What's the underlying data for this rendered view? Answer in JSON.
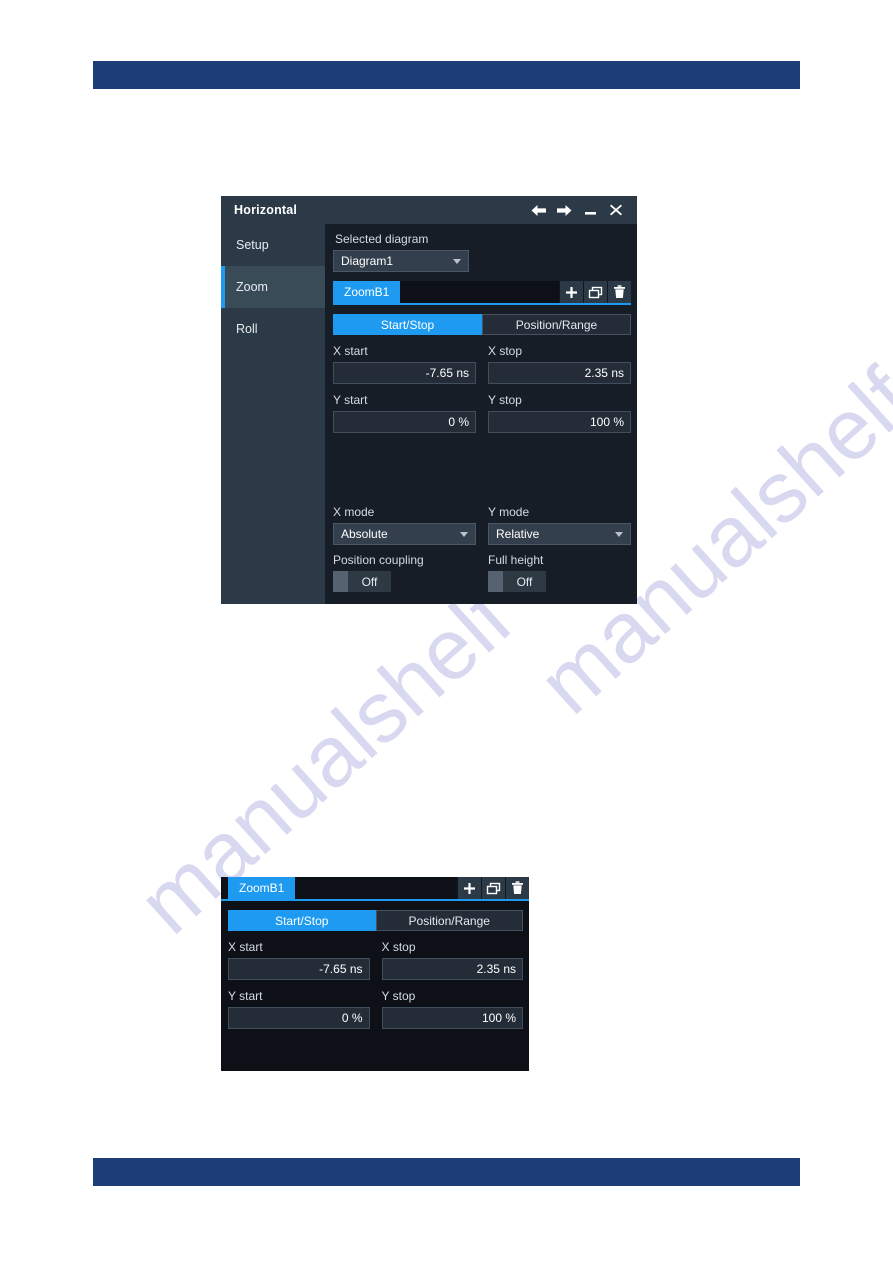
{
  "page": {
    "watermark_text": "manualshelf",
    "header_bar_color": "#1c3d75",
    "footer_bar_color": "#1c3d75"
  },
  "theme": {
    "accent": "#1e9bf0",
    "dialog_bg": "#161d26",
    "titlebar_bg": "#2b3a46",
    "sidebar_bg": "#2b3a46",
    "input_bg": "#232c37",
    "text": "#e8ecf2"
  },
  "dialog": {
    "title": "Horizontal",
    "titlebar_buttons": [
      {
        "name": "back-arrow-icon",
        "label": "Back"
      },
      {
        "name": "forward-arrow-icon",
        "label": "Forward"
      },
      {
        "name": "minimize-icon",
        "label": "Minimize"
      },
      {
        "name": "close-icon",
        "label": "Close"
      }
    ],
    "sidebar": {
      "items": [
        {
          "label": "Setup",
          "active": false
        },
        {
          "label": "Zoom",
          "active": true
        },
        {
          "label": "Roll",
          "active": false
        }
      ]
    },
    "selected_diagram": {
      "label": "Selected diagram",
      "value": "Diagram1",
      "options": [
        "Diagram1"
      ]
    },
    "zoom_tabs": {
      "active_tab": "ZoomB1",
      "toolbar": [
        {
          "name": "add-icon",
          "label": "Add"
        },
        {
          "name": "duplicate-icon",
          "label": "Duplicate"
        },
        {
          "name": "delete-icon",
          "label": "Delete"
        }
      ]
    },
    "mode_segmented": {
      "options": [
        "Start/Stop",
        "Position/Range"
      ],
      "selected": "Start/Stop"
    },
    "fields": {
      "x_start": {
        "label": "X start",
        "value": "-7.65 ns"
      },
      "x_stop": {
        "label": "X stop",
        "value": "2.35 ns"
      },
      "y_start": {
        "label": "Y start",
        "value": "0 %"
      },
      "y_stop": {
        "label": "Y stop",
        "value": "100 %"
      }
    },
    "modes": {
      "x_mode": {
        "label": "X mode",
        "value": "Absolute",
        "options": [
          "Absolute",
          "Relative"
        ]
      },
      "y_mode": {
        "label": "Y mode",
        "value": "Relative",
        "options": [
          "Absolute",
          "Relative"
        ]
      }
    },
    "toggles": {
      "position_coupling": {
        "label": "Position coupling",
        "state": "Off"
      },
      "full_height": {
        "label": "Full height",
        "state": "Off"
      }
    }
  },
  "panel2": {
    "zoom_tabs": {
      "active_tab": "ZoomB1",
      "toolbar": [
        {
          "name": "add-icon",
          "label": "Add"
        },
        {
          "name": "duplicate-icon",
          "label": "Duplicate"
        },
        {
          "name": "delete-icon",
          "label": "Delete"
        }
      ]
    },
    "mode_segmented": {
      "options": [
        "Start/Stop",
        "Position/Range"
      ],
      "selected": "Start/Stop"
    },
    "fields": {
      "x_start": {
        "label": "X start",
        "value": "-7.65 ns"
      },
      "x_stop": {
        "label": "X stop",
        "value": "2.35 ns"
      },
      "y_start": {
        "label": "Y start",
        "value": "0 %"
      },
      "y_stop": {
        "label": "Y stop",
        "value": "100 %"
      }
    }
  }
}
